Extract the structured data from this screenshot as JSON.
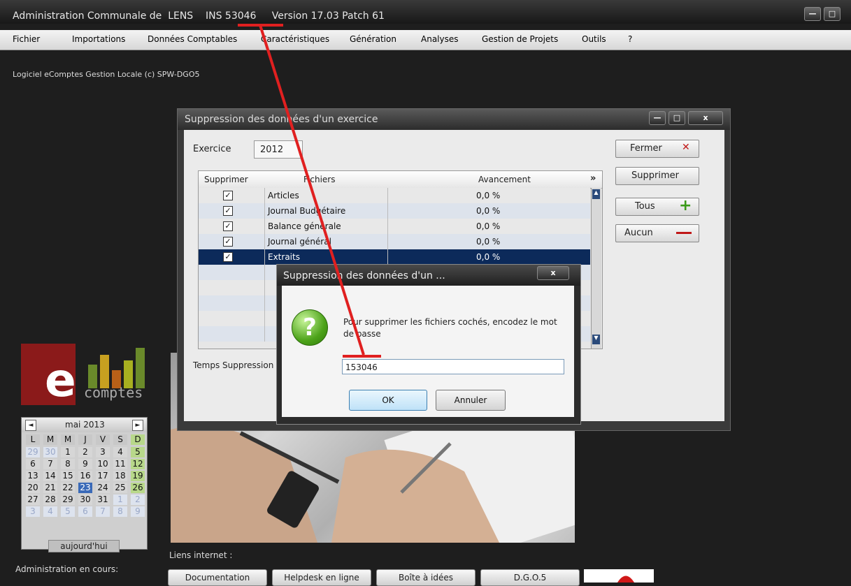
{
  "window": {
    "title": "Administration Communale de  LENS    INS 53046     Version 17.03 Patch 61",
    "minimize_icon": "minimize-icon",
    "maximize_icon": "maximize-icon"
  },
  "menu": {
    "items": [
      "Fichier",
      "Importations",
      "Données Comptables",
      "Caractéristiques",
      "Génération",
      "Analyses",
      "Gestion de Projets",
      "Outils",
      "?"
    ]
  },
  "software": "Logiciel eComptes Gestion Locale (c) SPW-DGO5",
  "logo": {
    "letter": "e",
    "word": "comptes",
    "colors": [
      "#6a8a2a",
      "#c8a020",
      "#b86018",
      "#a8b020",
      "#6a8a2a"
    ]
  },
  "calendar": {
    "month": "mai 2013",
    "prev": "◄",
    "next": "►",
    "weekdays": [
      "L",
      "M",
      "M",
      "J",
      "V",
      "S",
      "D"
    ],
    "weeks": [
      [
        "29",
        "30",
        "1",
        "2",
        "3",
        "4",
        "5"
      ],
      [
        "6",
        "7",
        "8",
        "9",
        "10",
        "11",
        "12"
      ],
      [
        "13",
        "14",
        "15",
        "16",
        "17",
        "18",
        "19"
      ],
      [
        "20",
        "21",
        "22",
        "23",
        "24",
        "25",
        "26"
      ],
      [
        "27",
        "28",
        "29",
        "30",
        "31",
        "1",
        "2"
      ],
      [
        "3",
        "4",
        "5",
        "6",
        "7",
        "8",
        "9"
      ]
    ],
    "today_label": "aujourd'hui",
    "selected": "23"
  },
  "admin_label": "Administration en cours:",
  "liens_label": "Liens internet :",
  "link_buttons": [
    "Documentation",
    "Helpdesk en ligne",
    "Boîte à idées",
    "D.G.O.5"
  ],
  "dialog": {
    "title": "Suppression des données d'un exercice",
    "exercice_label": "Exercice",
    "exercice_value": "2012",
    "columns": [
      "Supprimer",
      "Fichiers",
      "Avancement"
    ],
    "rows": [
      {
        "file": "Articles",
        "progress": "0,0 %"
      },
      {
        "file": "Journal Budgétaire",
        "progress": "0,0 %"
      },
      {
        "file": "Balance générale",
        "progress": "0,0 %"
      },
      {
        "file": "Journal général",
        "progress": "0,0 %"
      },
      {
        "file": "Extraits",
        "progress": "0,0 %"
      }
    ],
    "temps_label": "Temps Suppression",
    "buttons": {
      "fermer": "Fermer",
      "supprimer": "Supprimer",
      "tous": "Tous",
      "aucun": "Aucun"
    }
  },
  "modal": {
    "title": "Suppression des données d'un ...",
    "close_label": "x",
    "message": "Pour supprimer les fichiers cochés, encodez le mot de passe",
    "password_value": "153046",
    "ok": "OK",
    "cancel": "Annuler"
  },
  "colors": {
    "annotation": "#e02020",
    "accent": "#0c2a5a"
  }
}
